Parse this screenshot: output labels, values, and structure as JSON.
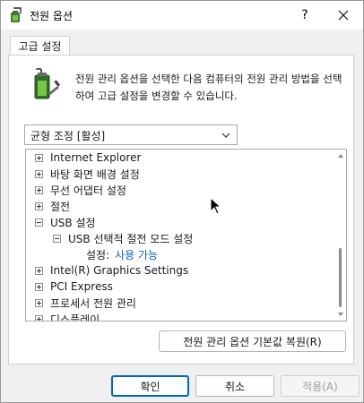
{
  "window": {
    "title": "전원 옵션",
    "help_label": "?",
    "colors": {
      "accent": "#0067c0",
      "link": "#0b5fb8",
      "disabled_text": "#9d9d9d"
    }
  },
  "tab": {
    "label": "고급 설정"
  },
  "description": "전원 관리 옵션을 선택한 다음 컴퓨터의 전원 관리 방법을 선택하여 고급 설정을 변경할 수 있습니다.",
  "plan_select": {
    "value": "균형 조정 [활성]"
  },
  "tree": {
    "items": [
      {
        "label": "Internet Explorer",
        "expander": "plus"
      },
      {
        "label": "바탕 화면 배경 설정",
        "expander": "plus"
      },
      {
        "label": "무선 어댑터 설정",
        "expander": "plus"
      },
      {
        "label": "절전",
        "expander": "plus"
      },
      {
        "label": "USB 설정",
        "expander": "minus"
      },
      {
        "label": "USB 선택적 절전 모드 설정",
        "expander": "minus"
      },
      {
        "setting_label": "설정:",
        "setting_value": "사용 가능"
      },
      {
        "label": "Intel(R) Graphics Settings",
        "expander": "plus"
      },
      {
        "label": "PCI Express",
        "expander": "plus"
      },
      {
        "label": "프로세서 전원 관리",
        "expander": "plus"
      },
      {
        "label": "디스플레이",
        "expander": "plus"
      }
    ]
  },
  "buttons": {
    "restore_defaults": "전원 관리 옵션 기본값 복원(R)",
    "ok": "확인",
    "cancel": "취소",
    "apply": "적용(A)"
  },
  "icons": {
    "title": "power-options-icon",
    "battery": "battery-plug-icon",
    "close": "close-icon",
    "dropdown": "chevron-down-icon"
  }
}
